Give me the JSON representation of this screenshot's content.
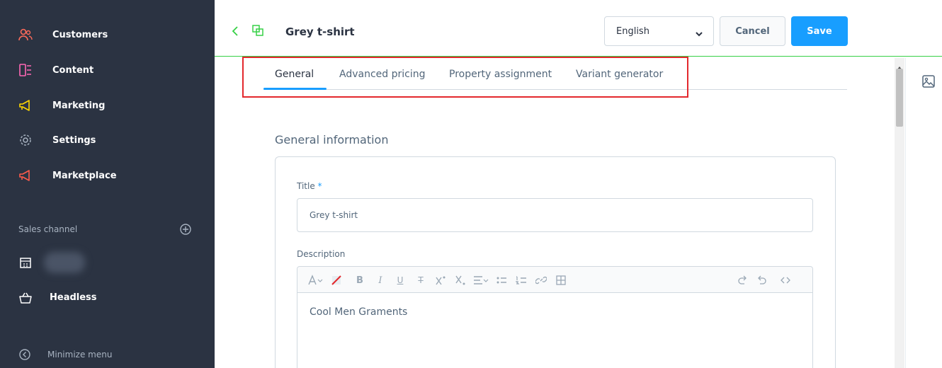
{
  "sidebar": {
    "items": [
      {
        "label": "Customers",
        "icon": "customers-icon",
        "color": "#ff6b5b"
      },
      {
        "label": "Content",
        "icon": "content-icon",
        "color": "#ff68b4"
      },
      {
        "label": "Marketing",
        "icon": "marketing-icon",
        "color": "#ffd700"
      },
      {
        "label": "Settings",
        "icon": "gear-icon",
        "color": "#a8b3c1"
      },
      {
        "label": "Marketplace",
        "icon": "marketplace-icon",
        "color": "#ff5b4b"
      }
    ],
    "sales_channel_label": "Sales channel",
    "sales_channels": [
      {
        "label": "",
        "icon": "storefront-icon"
      },
      {
        "label": "Headless",
        "icon": "basket-icon"
      }
    ],
    "minimize_label": "Minimize menu"
  },
  "header": {
    "title": "Grey t-shirt",
    "language": "English",
    "cancel_label": "Cancel",
    "save_label": "Save"
  },
  "tabs": [
    {
      "label": "General",
      "active": true
    },
    {
      "label": "Advanced pricing",
      "active": false
    },
    {
      "label": "Property assignment",
      "active": false
    },
    {
      "label": "Variant generator",
      "active": false
    }
  ],
  "general": {
    "section_title": "General information",
    "title_label": "Title",
    "title_required": "*",
    "title_value": "Grey t-shirt",
    "description_label": "Description",
    "description_value": "Cool Men Graments"
  },
  "colors": {
    "sidebar_bg": "#2b3342",
    "accent": "#189eff",
    "header_border": "#37d046",
    "highlight": "#e3282d"
  }
}
